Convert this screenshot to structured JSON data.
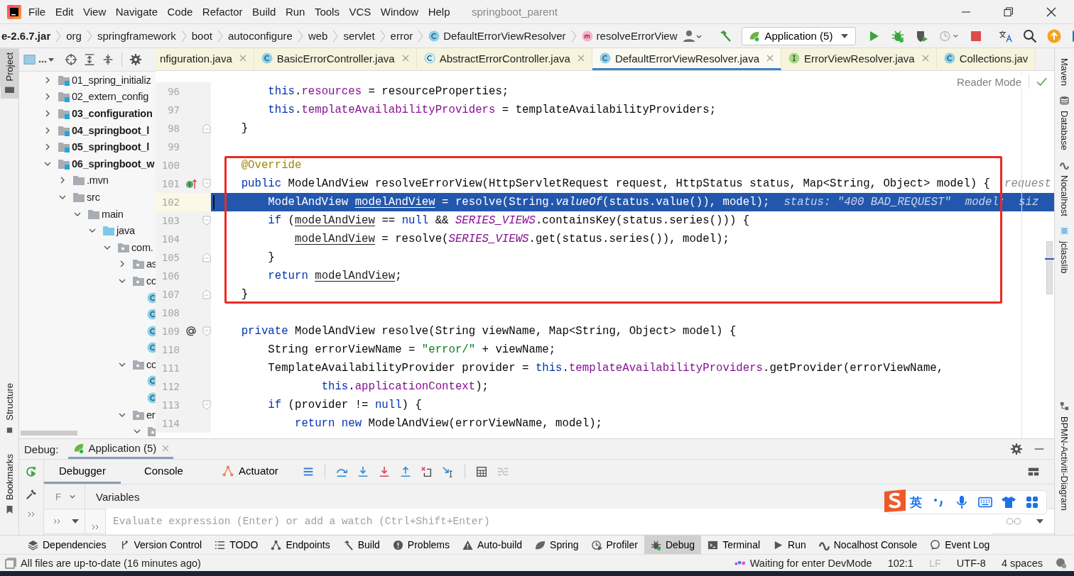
{
  "menu": {
    "items": [
      "File",
      "Edit",
      "View",
      "Navigate",
      "Code",
      "Refactor",
      "Build",
      "Run",
      "Tools",
      "VCS",
      "Window",
      "Help"
    ],
    "project_title": "springboot_parent"
  },
  "breadcrumbs": [
    {
      "label": "e-2.6.7.jar",
      "kind": "jar"
    },
    {
      "label": "org",
      "kind": "package"
    },
    {
      "label": "springframework",
      "kind": "package"
    },
    {
      "label": "boot",
      "kind": "package"
    },
    {
      "label": "autoconfigure",
      "kind": "package"
    },
    {
      "label": "web",
      "kind": "package"
    },
    {
      "label": "servlet",
      "kind": "package"
    },
    {
      "label": "error",
      "kind": "package"
    },
    {
      "label": "DefaultErrorViewResolver",
      "kind": "class"
    },
    {
      "label": "resolveErrorView",
      "kind": "method"
    }
  ],
  "run_config": {
    "label": "Application (5)"
  },
  "editor_tabs": [
    {
      "label": "nfiguration.java",
      "kind": "plain",
      "selected": false,
      "closable": true
    },
    {
      "label": "BasicErrorController.java",
      "kind": "class",
      "selected": false,
      "closable": true
    },
    {
      "label": "AbstractErrorController.java",
      "kind": "abstract",
      "selected": false,
      "closable": true
    },
    {
      "label": "DefaultErrorViewResolver.java",
      "kind": "class",
      "selected": true,
      "closable": true
    },
    {
      "label": "ErrorViewResolver.java",
      "kind": "interface",
      "selected": false,
      "closable": true
    },
    {
      "label": "Collections.jav",
      "kind": "class",
      "selected": false,
      "closable": false
    }
  ],
  "reader_mode": "Reader Mode",
  "project_tree": {
    "items": [
      {
        "label": "01_spring_initializ",
        "kind": "module",
        "bold": false,
        "expanded": false
      },
      {
        "label": "02_extern_config",
        "kind": "module",
        "bold": false,
        "expanded": false
      },
      {
        "label": "03_configuration",
        "kind": "module",
        "bold": true,
        "expanded": false
      },
      {
        "label": "04_springboot_l",
        "kind": "module",
        "bold": true,
        "expanded": false
      },
      {
        "label": "05_springboot_l",
        "kind": "module",
        "bold": true,
        "expanded": false
      },
      {
        "label": "06_springboot_w",
        "kind": "module",
        "bold": true,
        "expanded": true,
        "children": [
          {
            "label": ".mvn",
            "kind": "folder",
            "bold": false,
            "expanded": false
          },
          {
            "label": "src",
            "kind": "folder",
            "bold": false,
            "expanded": true,
            "children": [
              {
                "label": "main",
                "kind": "folder",
                "bold": false,
                "expanded": true,
                "children": [
                  {
                    "label": "java",
                    "kind": "source",
                    "bold": false,
                    "expanded": true,
                    "children": [
                      {
                        "label": "com.",
                        "kind": "package",
                        "bold": false,
                        "expanded": true,
                        "children": [
                          {
                            "label": "as",
                            "kind": "package",
                            "bold": false,
                            "expanded": false
                          },
                          {
                            "label": "co",
                            "kind": "package",
                            "bold": false,
                            "expanded": true,
                            "children": [
                              {
                                "kind": "class"
                              },
                              {
                                "kind": "class"
                              },
                              {
                                "kind": "class"
                              },
                              {
                                "kind": "class"
                              }
                            ]
                          },
                          {
                            "label": "co",
                            "kind": "package",
                            "bold": false,
                            "expanded": true,
                            "children": [
                              {
                                "kind": "class"
                              },
                              {
                                "kind": "class"
                              }
                            ]
                          },
                          {
                            "label": "er",
                            "kind": "package",
                            "bold": false,
                            "expanded": true,
                            "children": [
                              {
                                "kind": "package",
                                "expanded": true
                              }
                            ]
                          }
                        ]
                      }
                    ]
                  }
                ]
              }
            ]
          }
        ]
      }
    ]
  },
  "code": {
    "lines": [
      {
        "number": "96",
        "selected": false,
        "boxed": false,
        "fold_start": false,
        "fold_end": false,
        "implements": false,
        "annotated": false,
        "tokens": [
          {
            "text": "        this",
            "kind": "keyword"
          },
          {
            "text": ".",
            "kind": "plain"
          },
          {
            "text": "resources",
            "kind": "field"
          },
          {
            "text": " = resourceProperties;",
            "kind": "plain"
          }
        ]
      },
      {
        "number": "97",
        "selected": false,
        "boxed": false,
        "fold_start": false,
        "fold_end": false,
        "implements": false,
        "annotated": false,
        "tokens": [
          {
            "text": "        this",
            "kind": "keyword"
          },
          {
            "text": ".",
            "kind": "plain"
          },
          {
            "text": "templateAvailabilityProviders",
            "kind": "field"
          },
          {
            "text": " = templateAvailabilityProviders;",
            "kind": "plain"
          }
        ]
      },
      {
        "number": "98",
        "selected": false,
        "boxed": false,
        "fold_start": false,
        "fold_end": true,
        "implements": false,
        "annotated": false,
        "tokens": [
          {
            "text": "    }",
            "kind": "plain"
          }
        ]
      },
      {
        "number": "99",
        "selected": false,
        "boxed": false,
        "fold_start": false,
        "fold_end": false,
        "implements": false,
        "annotated": false
      },
      {
        "number": "100",
        "selected": false,
        "boxed": true,
        "fold_start": false,
        "fold_end": false,
        "implements": false,
        "annotated": false,
        "tokens": [
          {
            "text": "    @Override",
            "kind": "annotation"
          }
        ]
      },
      {
        "number": "101",
        "selected": false,
        "boxed": true,
        "fold_start": true,
        "fold_end": false,
        "implements": true,
        "annotated": false,
        "tokens": [
          {
            "text": "    public",
            "kind": "keyword"
          },
          {
            "text": " ModelAndView resolveErrorView(HttpServletRequest request, HttpStatus status, Map<String, Object> model) {",
            "kind": "plain"
          }
        ],
        "hints": [
          "request"
        ]
      },
      {
        "number": "102",
        "selected": true,
        "boxed": true,
        "fold_start": false,
        "fold_end": false,
        "implements": false,
        "annotated": false,
        "tokens": [
          {
            "text": "        ModelAndView ",
            "kind": "plain"
          },
          {
            "text": "modelAndView",
            "kind": "reassigned"
          },
          {
            "text": " = resolve(String.",
            "kind": "plain"
          },
          {
            "text": "valueOf",
            "kind": "italic"
          },
          {
            "text": "(status.value()), model);",
            "kind": "plain"
          }
        ],
        "hints": [
          "status: \"400 BAD_REQUEST\"",
          "model:  siz"
        ]
      },
      {
        "number": "103",
        "selected": false,
        "boxed": true,
        "fold_start": true,
        "fold_end": false,
        "implements": false,
        "annotated": false,
        "tokens": [
          {
            "text": "        if",
            "kind": "keyword"
          },
          {
            "text": " (",
            "kind": "plain"
          },
          {
            "text": "modelAndView",
            "kind": "reassigned"
          },
          {
            "text": " == ",
            "kind": "plain"
          },
          {
            "text": "null",
            "kind": "keyword"
          },
          {
            "text": " && ",
            "kind": "plain"
          },
          {
            "text": "SERIES_VIEWS",
            "kind": "constant"
          },
          {
            "text": ".containsKey(status.series())) {",
            "kind": "plain"
          }
        ]
      },
      {
        "number": "104",
        "selected": false,
        "boxed": true,
        "fold_start": false,
        "fold_end": false,
        "implements": false,
        "annotated": false,
        "tokens": [
          {
            "text": "            modelAndView",
            "kind": "reassigned"
          },
          {
            "text": " = resolve(",
            "kind": "plain"
          },
          {
            "text": "SERIES_VIEWS",
            "kind": "constant"
          },
          {
            "text": ".get(status.series()), model);",
            "kind": "plain"
          }
        ]
      },
      {
        "number": "105",
        "selected": false,
        "boxed": true,
        "fold_start": false,
        "fold_end": true,
        "implements": false,
        "annotated": false,
        "tokens": [
          {
            "text": "        }",
            "kind": "plain"
          }
        ]
      },
      {
        "number": "106",
        "selected": false,
        "boxed": true,
        "fold_start": false,
        "fold_end": false,
        "implements": false,
        "annotated": false,
        "tokens": [
          {
            "text": "        return ",
            "kind": "keyword"
          },
          {
            "text": "modelAndView",
            "kind": "reassigned"
          },
          {
            "text": ";",
            "kind": "plain"
          }
        ]
      },
      {
        "number": "107",
        "selected": false,
        "boxed": true,
        "fold_start": false,
        "fold_end": true,
        "implements": false,
        "annotated": false,
        "tokens": [
          {
            "text": "    }",
            "kind": "plain"
          }
        ]
      },
      {
        "number": "108",
        "selected": false,
        "boxed": false,
        "fold_start": false,
        "fold_end": false,
        "implements": false,
        "annotated": false
      },
      {
        "number": "109",
        "selected": false,
        "boxed": false,
        "fold_start": true,
        "fold_end": false,
        "implements": false,
        "annotated": true,
        "tokens": [
          {
            "text": "    private",
            "kind": "keyword"
          },
          {
            "text": " ModelAndView resolve(String viewName, Map<String, Object> model) {",
            "kind": "plain"
          }
        ]
      },
      {
        "number": "110",
        "selected": false,
        "boxed": false,
        "fold_start": false,
        "fold_end": false,
        "implements": false,
        "annotated": false,
        "tokens": [
          {
            "text": "        String errorViewName = ",
            "kind": "plain"
          },
          {
            "text": "\"error/\"",
            "kind": "string"
          },
          {
            "text": " + viewName;",
            "kind": "plain"
          }
        ]
      },
      {
        "number": "111",
        "selected": false,
        "boxed": false,
        "fold_start": false,
        "fold_end": false,
        "implements": false,
        "annotated": false,
        "tokens": [
          {
            "text": "        TemplateAvailabilityProvider provider = ",
            "kind": "plain"
          },
          {
            "text": "this",
            "kind": "keyword"
          },
          {
            "text": ".",
            "kind": "plain"
          },
          {
            "text": "templateAvailabilityProviders",
            "kind": "field"
          },
          {
            "text": ".getProvider(errorViewName,",
            "kind": "plain"
          }
        ]
      },
      {
        "number": "112",
        "selected": false,
        "boxed": false,
        "fold_start": false,
        "fold_end": false,
        "implements": false,
        "annotated": false,
        "tokens": [
          {
            "text": "                this",
            "kind": "keyword"
          },
          {
            "text": ".",
            "kind": "plain"
          },
          {
            "text": "applicationContext",
            "kind": "field"
          },
          {
            "text": ");",
            "kind": "plain"
          }
        ]
      },
      {
        "number": "113",
        "selected": false,
        "boxed": false,
        "fold_start": true,
        "fold_end": false,
        "implements": false,
        "annotated": false,
        "tokens": [
          {
            "text": "        if",
            "kind": "keyword"
          },
          {
            "text": " (provider != ",
            "kind": "plain"
          },
          {
            "text": "null",
            "kind": "keyword"
          },
          {
            "text": ") {",
            "kind": "plain"
          }
        ]
      },
      {
        "number": "114",
        "selected": false,
        "boxed": false,
        "fold_start": false,
        "fold_end": false,
        "implements": false,
        "annotated": false,
        "tokens": [
          {
            "text": "            return new",
            "kind": "keyword"
          },
          {
            "text": " ModelAndView(errorViewName, model);",
            "kind": "plain"
          }
        ]
      }
    ]
  },
  "left_stripe": [
    {
      "label": "Project",
      "selected": true
    },
    {
      "label": "Structure",
      "selected": false
    },
    {
      "label": "Bookmarks",
      "selected": false
    }
  ],
  "right_stripe": [
    {
      "label": "Maven",
      "kind": "maven"
    },
    {
      "label": "Database",
      "kind": "database"
    },
    {
      "label": "Nocalhost",
      "kind": "nocalhost"
    },
    {
      "label": "jclasslib",
      "kind": "jclasslib"
    },
    {
      "label": "BPMN-Activiti-Diagram",
      "kind": "diagram"
    }
  ],
  "debug": {
    "title": "Debug:",
    "session": "Application (5)",
    "tabs": [
      {
        "label": "Debugger",
        "selected": true
      },
      {
        "label": "Console",
        "selected": false
      },
      {
        "label": "Actuator",
        "selected": false
      }
    ],
    "frames_label": "F",
    "variables_label": "Variables",
    "evaluate": {
      "placeholder": "Evaluate expression (Enter) or add a watch (Ctrl+Shift+Enter)"
    }
  },
  "ime_toolbar": {
    "mode": "英"
  },
  "tool_windows": [
    {
      "label": "Dependencies",
      "kind": "layers",
      "selected": false
    },
    {
      "label": "Version Control",
      "kind": "branch",
      "selected": false
    },
    {
      "label": "TODO",
      "kind": "list",
      "selected": false
    },
    {
      "label": "Endpoints",
      "kind": "nodes",
      "selected": false
    },
    {
      "label": "Build",
      "kind": "hammer",
      "selected": false
    },
    {
      "label": "Problems",
      "kind": "alert",
      "selected": false
    },
    {
      "label": "Auto-build",
      "kind": "warning",
      "selected": false
    },
    {
      "label": "Spring",
      "kind": "leaf",
      "selected": false
    },
    {
      "label": "Profiler",
      "kind": "clock",
      "selected": false
    },
    {
      "label": "Debug",
      "kind": "bug",
      "selected": true
    },
    {
      "label": "Terminal",
      "kind": "terminal",
      "selected": false
    },
    {
      "label": "Run",
      "kind": "play",
      "selected": false
    },
    {
      "label": "Nocalhost Console",
      "kind": "wave",
      "selected": false
    },
    {
      "label": "Event Log",
      "kind": "bubble",
      "selected": false
    }
  ],
  "status_bar": {
    "message": "All files are up-to-date (16 minutes ago)",
    "devmode": "Waiting for enter DevMode",
    "position": "102:1",
    "line_separator": "LF",
    "encoding": "UTF-8",
    "indent": "4 spaces"
  }
}
